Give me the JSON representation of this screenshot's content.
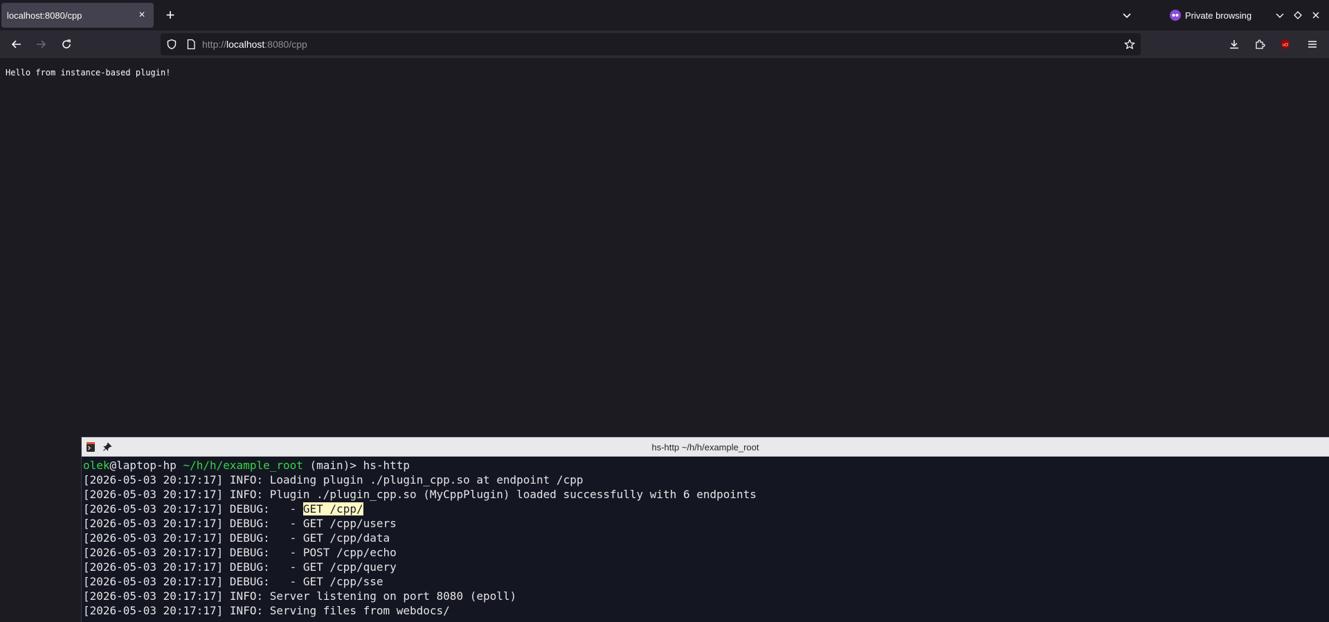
{
  "browser": {
    "tab": {
      "title": "localhost:8080/cpp",
      "close_label": "×"
    },
    "new_tab_label": "+",
    "private_label": "Private browsing",
    "url": {
      "scheme": "http://",
      "host": "localhost",
      "rest": ":8080/cpp"
    }
  },
  "page": {
    "text": "Hello from instance-based plugin!"
  },
  "terminal": {
    "title": "hs-http ~/h/h/example_root",
    "prompt": {
      "user": "olek",
      "host": "@laptop-hp",
      "path": " ~/h/h/example_root",
      "branch": " (main)> ",
      "command": "hs-http"
    },
    "lines": [
      "[2026-05-03 20:17:17] INFO: Loading plugin ./plugin_cpp.so at endpoint /cpp",
      "[2026-05-03 20:17:17] INFO: Plugin ./plugin_cpp.so (MyCppPlugin) loaded successfully with 6 endpoints",
      "[2026-05-03 20:17:17] DEBUG:   - ",
      "[2026-05-03 20:17:17] DEBUG:   - GET /cpp/users",
      "[2026-05-03 20:17:17] DEBUG:   - GET /cpp/data",
      "[2026-05-03 20:17:17] DEBUG:   - POST /cpp/echo",
      "[2026-05-03 20:17:17] DEBUG:   - GET /cpp/query",
      "[2026-05-03 20:17:17] DEBUG:   - GET /cpp/sse",
      "[2026-05-03 20:17:17] INFO: Server listening on port 8080 (epoll)",
      "[2026-05-03 20:17:17] INFO: Serving files from webdocs/"
    ],
    "highlighted": "GET /cpp/"
  }
}
